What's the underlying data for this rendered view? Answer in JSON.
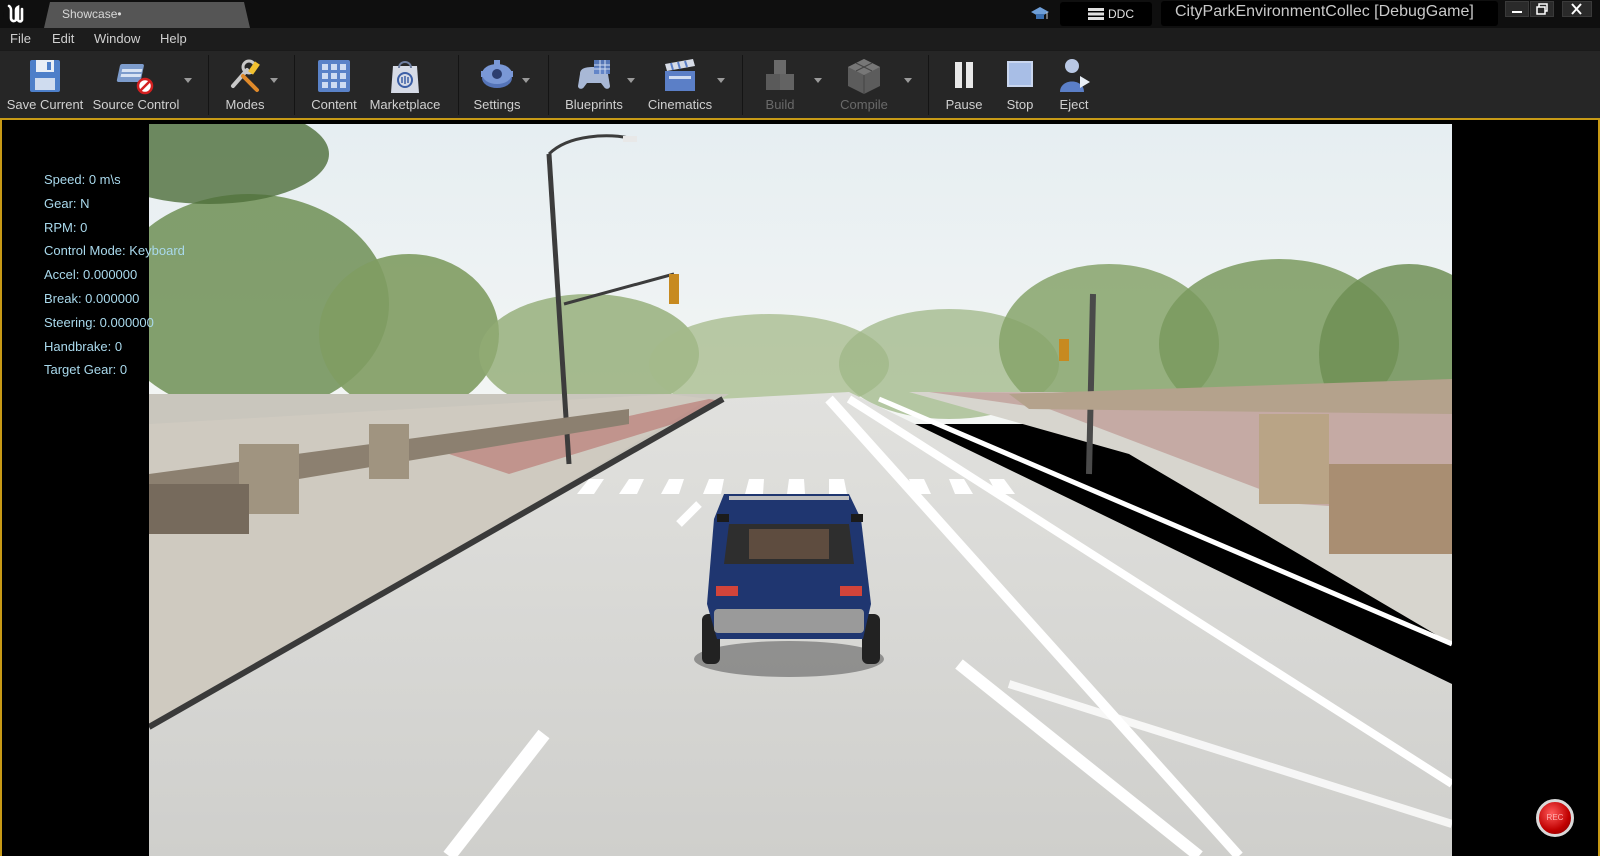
{
  "window": {
    "tab_title": "Showcase•",
    "ddc_label": "DDC",
    "project_title": "CityParkEnvironmentCollec [DebugGame]"
  },
  "menu": [
    "File",
    "Edit",
    "Window",
    "Help"
  ],
  "toolbar": {
    "save_current": "Save Current",
    "source_control": "Source Control",
    "modes": "Modes",
    "content": "Content",
    "marketplace": "Marketplace",
    "settings": "Settings",
    "blueprints": "Blueprints",
    "cinematics": "Cinematics",
    "build": "Build",
    "compile": "Compile",
    "pause": "Pause",
    "stop": "Stop",
    "eject": "Eject"
  },
  "hud": [
    "Speed: 0 m\\s",
    "Gear: N",
    "RPM: 0",
    "Control Mode: Keyboard",
    "Accel: 0.000000",
    "Break: 0.000000",
    "Steering: 0.000000",
    "Handbrake: 0",
    "Target Gear: 0"
  ],
  "rec_label": "REC",
  "colors": {
    "accent_border": "#c79a16",
    "hud_text": "#a9d9ec",
    "car": "#1f3670"
  }
}
